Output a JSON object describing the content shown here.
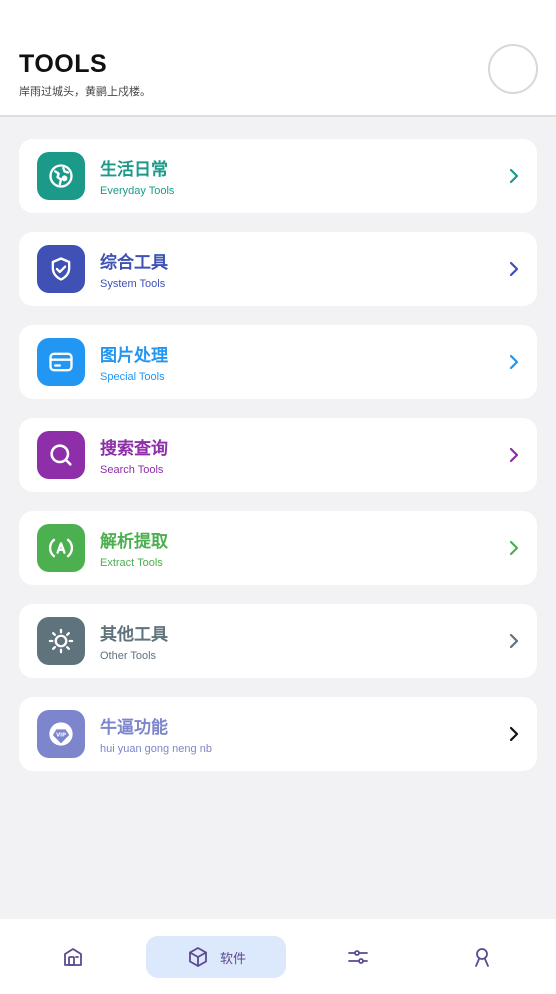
{
  "header": {
    "title": "TOOLS",
    "subtitle": "岸雨过城头，黄鹂上戍楼。"
  },
  "cards": [
    {
      "title": "生活日常",
      "subtitle": "Everyday Tools",
      "color": "#1b9a8a",
      "icon": "globe-icon"
    },
    {
      "title": "综合工具",
      "subtitle": "System Tools",
      "color": "#3f51b5",
      "icon": "shield-icon"
    },
    {
      "title": "图片处理",
      "subtitle": "Special Tools",
      "color": "#2196f3",
      "icon": "card-icon"
    },
    {
      "title": "搜索查询",
      "subtitle": "Search Tools",
      "color": "#8e2ea8",
      "icon": "search-icon"
    },
    {
      "title": "解析提取",
      "subtitle": "Extract Tools",
      "color": "#4caf50",
      "icon": "extract-icon"
    },
    {
      "title": "其他工具",
      "subtitle": "Other Tools",
      "color": "#5f737d",
      "icon": "sun-icon"
    },
    {
      "title": "牛逼功能",
      "subtitle": "hui yuan gong neng nb",
      "color": "#7d86cc",
      "icon": "vip-icon",
      "chevron_color": "#111111"
    }
  ],
  "nav": {
    "active_label": "软件",
    "items": [
      "home-icon",
      "box-icon",
      "sliders-icon",
      "user-icon"
    ]
  }
}
